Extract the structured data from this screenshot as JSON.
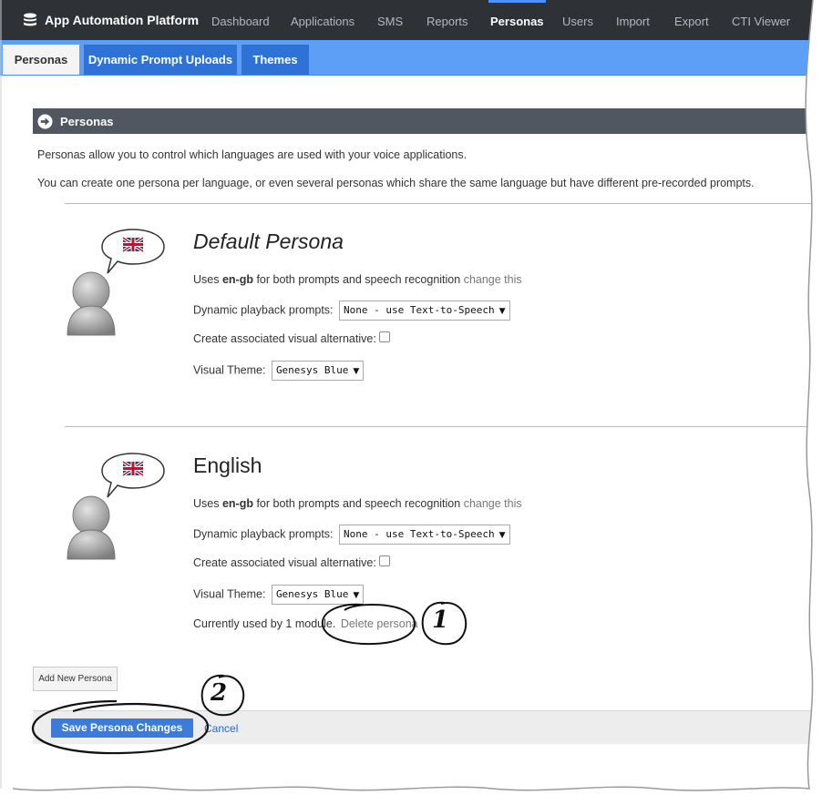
{
  "topnav": {
    "brand": "App Automation Platform",
    "items": [
      "Dashboard",
      "Applications",
      "SMS",
      "Reports",
      "Personas",
      "Users",
      "Import",
      "Export",
      "CTI Viewer"
    ],
    "active_index": 4
  },
  "subnav": {
    "tabs": [
      "Personas",
      "Dynamic Prompt Uploads",
      "Themes"
    ],
    "active_index": 0
  },
  "section": {
    "title": "Personas",
    "intro1": "Personas allow you to control which languages are used with your voice applications.",
    "intro2": "You can create one persona per language, or even several personas which share the same language but have different pre-recorded prompts."
  },
  "personas": [
    {
      "name": "Default Persona",
      "uses_prefix": "Uses ",
      "language": "en-gb",
      "uses_suffix": " for both prompts and speech recognition ",
      "change_link": "change this",
      "dynamic_label": "Dynamic playback prompts:",
      "dynamic_value": "None - use Text-to-Speech",
      "visual_alt_label": "Create associated visual alternative:",
      "visual_alt_checked": false,
      "theme_label": "Visual Theme:",
      "theme_value": "Genesys Blue"
    },
    {
      "name": "English",
      "uses_prefix": "Uses ",
      "language": "en-gb",
      "uses_suffix": " for both prompts and speech recognition ",
      "change_link": "change this",
      "dynamic_label": "Dynamic playback prompts:",
      "dynamic_value": "None - use Text-to-Speech",
      "visual_alt_label": "Create associated visual alternative:",
      "visual_alt_checked": false,
      "theme_label": "Visual Theme:",
      "theme_value": "Genesys Blue",
      "usage_text": "Currently used by 1 module.",
      "delete_link": "Delete persona"
    }
  ],
  "actions": {
    "add_label": "Add New Persona",
    "save_label": "Save Persona Changes",
    "cancel_label": "Cancel"
  },
  "callouts": [
    "1",
    "2"
  ],
  "colors": {
    "navbar": "#2e3136",
    "subnav": "#5d9ef6",
    "subtab": "#2f72d6",
    "section_header": "#505760",
    "primary_button": "#3d7bd9",
    "link": "#1f6bd0"
  }
}
